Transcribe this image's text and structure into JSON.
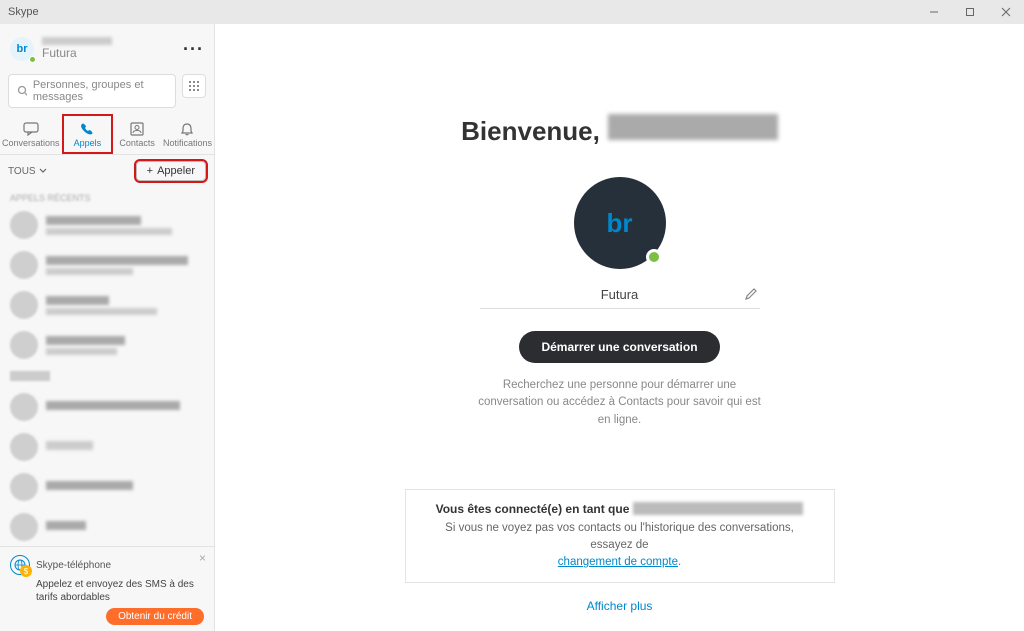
{
  "window": {
    "title": "Skype"
  },
  "sidebar": {
    "profile": {
      "initials": "br",
      "display_name": "Futura"
    },
    "search_placeholder": "Personnes, groupes et messages",
    "more_label": "···",
    "tabs": [
      {
        "key": "conversations",
        "label": "Conversations"
      },
      {
        "key": "appels",
        "label": "Appels"
      },
      {
        "key": "contacts",
        "label": "Contacts"
      },
      {
        "key": "notifications",
        "label": "Notifications"
      }
    ],
    "filter_label": "TOUS",
    "call_button": "Appeler",
    "section_header": "APPELS RÉCENTS",
    "promo": {
      "title": "Skype-téléphone",
      "body": "Appelez et envoyez des SMS à des tarifs abordables",
      "cta": "Obtenir du crédit"
    }
  },
  "main": {
    "welcome_prefix": "Bienvenue,",
    "avatar_initials": "br",
    "display_name": "Futura",
    "start_conversation": "Démarrer une conversation",
    "hint": "Recherchez une personne pour démarrer une conversation ou accédez à Contacts pour savoir qui est en ligne.",
    "account": {
      "line1": "Vous êtes connecté(e) en tant que",
      "line2_a": "Si vous ne voyez pas vos contacts ou l'historique des conversations, essayez de",
      "link": "changement de compte"
    },
    "show_more": "Afficher plus"
  }
}
